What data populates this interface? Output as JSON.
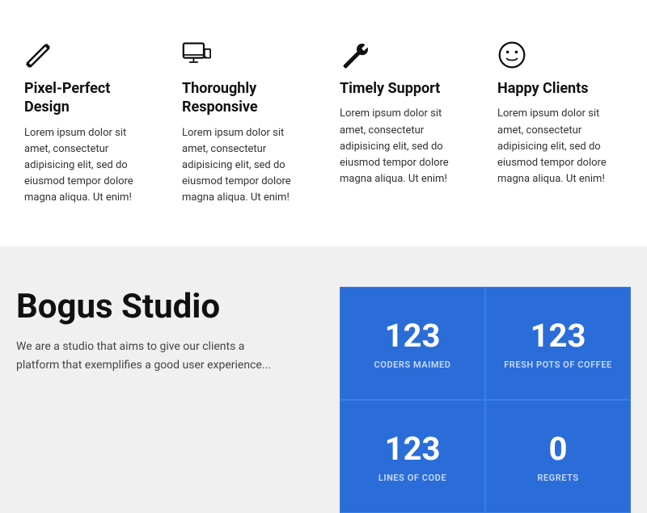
{
  "features": [
    {
      "id": "pixel-perfect",
      "icon": "pencil",
      "title": "Pixel-Perfect Design",
      "text": "Lorem ipsum dolor sit amet, consectetur adipisicing elit, sed do eiusmod tempor dolore magna aliqua. Ut enim!"
    },
    {
      "id": "responsive",
      "icon": "monitor",
      "title": "Thoroughly Responsive",
      "text": "Lorem ipsum dolor sit amet, consectetur adipisicing elit, sed do eiusmod tempor dolore magna aliqua. Ut enim!"
    },
    {
      "id": "support",
      "icon": "wrench",
      "title": "Timely Support",
      "text": "Lorem ipsum dolor sit amet, consectetur adipisicing elit, sed do eiusmod tempor dolore magna aliqua. Ut enim!"
    },
    {
      "id": "clients",
      "icon": "smiley",
      "title": "Happy Clients",
      "text": "Lorem ipsum dolor sit amet, consectetur adipisicing elit, sed do eiusmod tempor dolore magna aliqua. Ut enim!"
    }
  ],
  "studio": {
    "title": "Bogus Studio",
    "description": "We are a studio that aims to give our clients a platform that exemplifies a good user experience..."
  },
  "stats": [
    {
      "number": "123",
      "label": "CODERS MAIMED"
    },
    {
      "number": "123",
      "label": "FRESH POTS OF COFFEE"
    },
    {
      "number": "123",
      "label": "LINES OF CODE"
    },
    {
      "number": "0",
      "label": "REGRETS"
    }
  ]
}
